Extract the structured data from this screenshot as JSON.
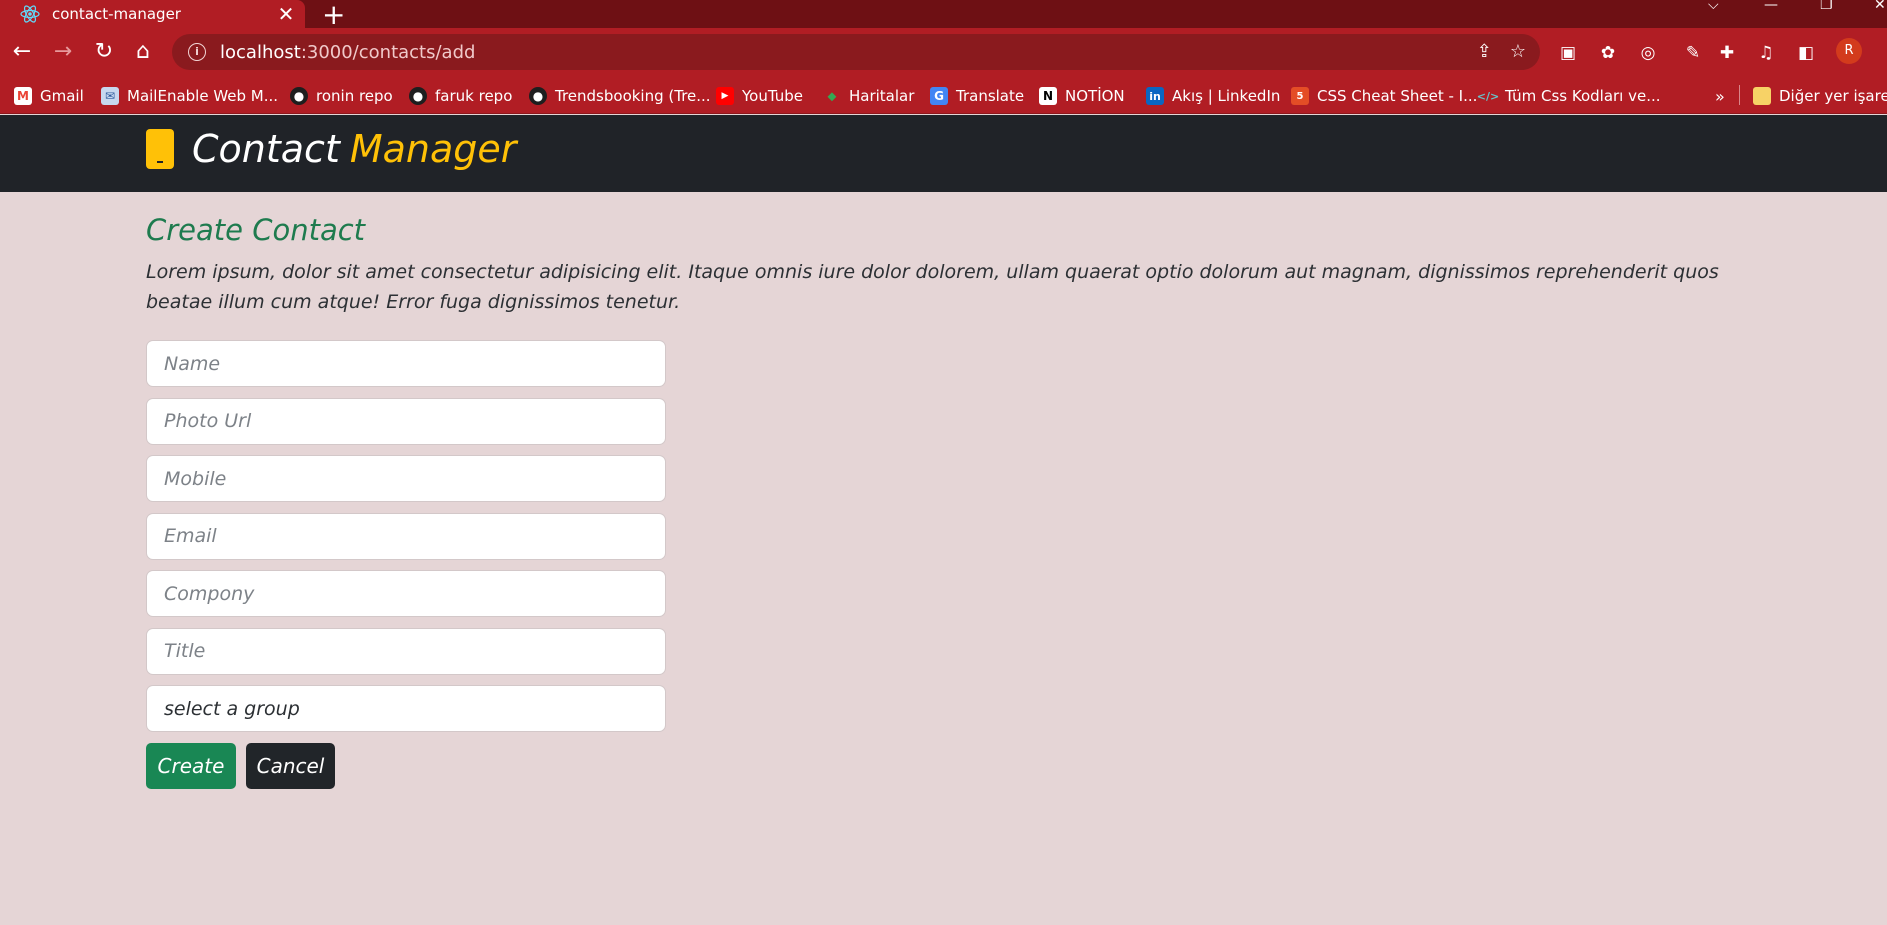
{
  "browser": {
    "tab_title": "contact-manager",
    "close_glyph": "✕",
    "new_tab_glyph": "+",
    "url_host": "localhost",
    "url_path": ":3000/contacts/add",
    "profile_initial": "R"
  },
  "bookmarks": [
    {
      "label": "Gmail",
      "icon": "gmail-icon"
    },
    {
      "label": "MailEnable Web M...",
      "icon": "mail-icon"
    },
    {
      "label": "ronin repo",
      "icon": "github-icon"
    },
    {
      "label": "faruk repo",
      "icon": "github-icon"
    },
    {
      "label": "Trendsbooking (Tre...",
      "icon": "github-icon"
    },
    {
      "label": "YouTube",
      "icon": "youtube-icon"
    },
    {
      "label": "Haritalar",
      "icon": "maps-icon"
    },
    {
      "label": "Translate",
      "icon": "translate-icon"
    },
    {
      "label": "NOTİON",
      "icon": "notion-icon"
    },
    {
      "label": "Akış | LinkedIn",
      "icon": "linkedin-icon"
    },
    {
      "label": "CSS Cheat Sheet - I...",
      "icon": "html-icon"
    },
    {
      "label": "Tüm Css Kodları ve...",
      "icon": "code-icon"
    }
  ],
  "bookmarks_more": "»",
  "other_bookmarks": "Diğer yer işaretl",
  "app": {
    "brand_first": "Contact",
    "brand_second": "Manager"
  },
  "page": {
    "title": "Create Contact",
    "description": "Lorem ipsum, dolor sit amet consectetur adipisicing elit. Itaque omnis iure dolor dolorem, ullam quaerat optio dolorum aut magnam, dignissimos reprehenderit quos beatae illum cum atque! Error fuga dignissimos tenetur."
  },
  "form": {
    "name_placeholder": "Name",
    "photo_placeholder": "Photo Url",
    "mobile_placeholder": "Mobile",
    "email_placeholder": "Email",
    "company_placeholder": "Compony",
    "title_placeholder": "Title",
    "group_selected": "select a group",
    "create_label": "Create",
    "cancel_label": "Cancel"
  },
  "colors": {
    "browser_red": "#b11d24",
    "navbar_dark": "#202328",
    "accent_yellow": "#ffc107",
    "title_green": "#1e7b4e",
    "create_green": "#198754",
    "page_bg": "#e5d5d6"
  }
}
